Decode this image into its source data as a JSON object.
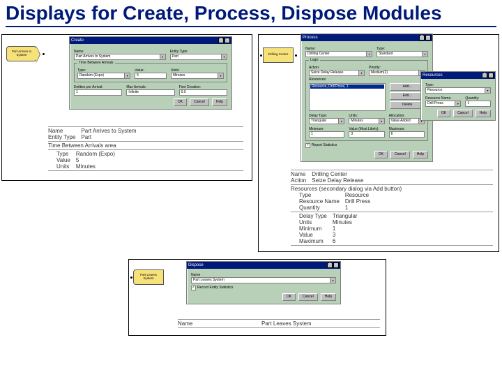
{
  "title": "Displays for Create, Process, Dispose Modules",
  "create": {
    "module_label": "Part Arrives to System",
    "dialog": {
      "title": "Create",
      "name_label": "Name:",
      "name_value": "Part Arrives to System",
      "entity_type_label": "Entity Type:",
      "entity_type_value": "Part",
      "group_title": "Time Between Arrivals",
      "type_label": "Type:",
      "type_value": "Random (Expo)",
      "value_label": "Value:",
      "value_value": "5",
      "units_label": "Units:",
      "units_value": "Minutes",
      "eba_label": "Entities per Arrival:",
      "eba_value": "1",
      "max_label": "Max Arrivals:",
      "max_value": "Infinite",
      "first_label": "First Creation:",
      "first_value": "0.0",
      "ok": "OK",
      "cancel": "Cancel",
      "help": "Help"
    },
    "info": {
      "rows": [
        {
          "k": "Name",
          "v": "Part Arrives to System"
        },
        {
          "k": "Entity Type",
          "v": "Part"
        }
      ],
      "sub_header": "Time Between Arrivals area",
      "sub_rows": [
        {
          "k": "Type",
          "v": "Random (Expo)"
        },
        {
          "k": "Value",
          "v": "5"
        },
        {
          "k": "Units",
          "v": "Minutes"
        }
      ]
    }
  },
  "process": {
    "module_label": "Drilling Center",
    "dialog": {
      "title": "Process",
      "name_label": "Name:",
      "name_value": "Drilling Center",
      "type_label": "Type:",
      "type_value": "Standard",
      "logic_label": "Logic",
      "action_label": "Action:",
      "action_value": "Seize Delay Release",
      "priority_label": "Priority:",
      "priority_value": "Medium(2)",
      "resources_label": "Resources:",
      "resource_item": "Resource, Drill Press, 1",
      "add": "Add...",
      "edit": "Edit...",
      "delete": "Delete",
      "delay_type_label": "Delay Type:",
      "delay_type_value": "Triangular",
      "units_label": "Units:",
      "units_value": "Minutes",
      "alloc_label": "Allocation:",
      "alloc_value": "Value Added",
      "min_label": "Minimum:",
      "min_value": "1",
      "val_label": "Value (Most Likely):",
      "val_value": "3",
      "maxv_label": "Maximum:",
      "maxv_value": "6",
      "report_label": "Report Statistics",
      "ok": "OK",
      "cancel": "Cancel",
      "help": "Help"
    },
    "res_dialog": {
      "title": "Resources",
      "type_label": "Type:",
      "type_value": "Resource",
      "rname_label": "Resource Name:",
      "rname_value": "Drill Press",
      "qty_label": "Quantity:",
      "qty_value": "1",
      "ok": "OK",
      "cancel": "Cancel",
      "help": "Help"
    },
    "info": {
      "rows": [
        {
          "k": "Name",
          "v": "Drilling Center"
        },
        {
          "k": "Action",
          "v": "Seize Delay Release"
        }
      ],
      "sub_header": "Resources (secondary dialog via Add button)",
      "sub_rows": [
        {
          "k": "Type",
          "v": "Resource"
        },
        {
          "k": "Resource Name",
          "v": "Drill Press"
        },
        {
          "k": "Quantity",
          "v": "1"
        }
      ],
      "sub2_rows": [
        {
          "k": "Delay Type",
          "v": "Triangular"
        },
        {
          "k": "Units",
          "v": "Minutes"
        },
        {
          "k": "Minimum",
          "v": "1"
        },
        {
          "k": "Value",
          "v": "3"
        },
        {
          "k": "Maximum",
          "v": "6"
        }
      ]
    }
  },
  "dispose": {
    "module_label": "Part Leaves System",
    "dialog": {
      "title": "Dispose",
      "name_label": "Name",
      "name_value": "Part Leaves System",
      "record_label": "Record Entity Statistics",
      "ok": "OK",
      "cancel": "Cancel",
      "help": "Help"
    },
    "info": {
      "rows": [
        {
          "k": "Name",
          "v": "Part Leaves System"
        }
      ]
    }
  },
  "icons": {
    "help_q": "?",
    "close_x": "×",
    "check": "✓",
    "dd": "▾"
  }
}
